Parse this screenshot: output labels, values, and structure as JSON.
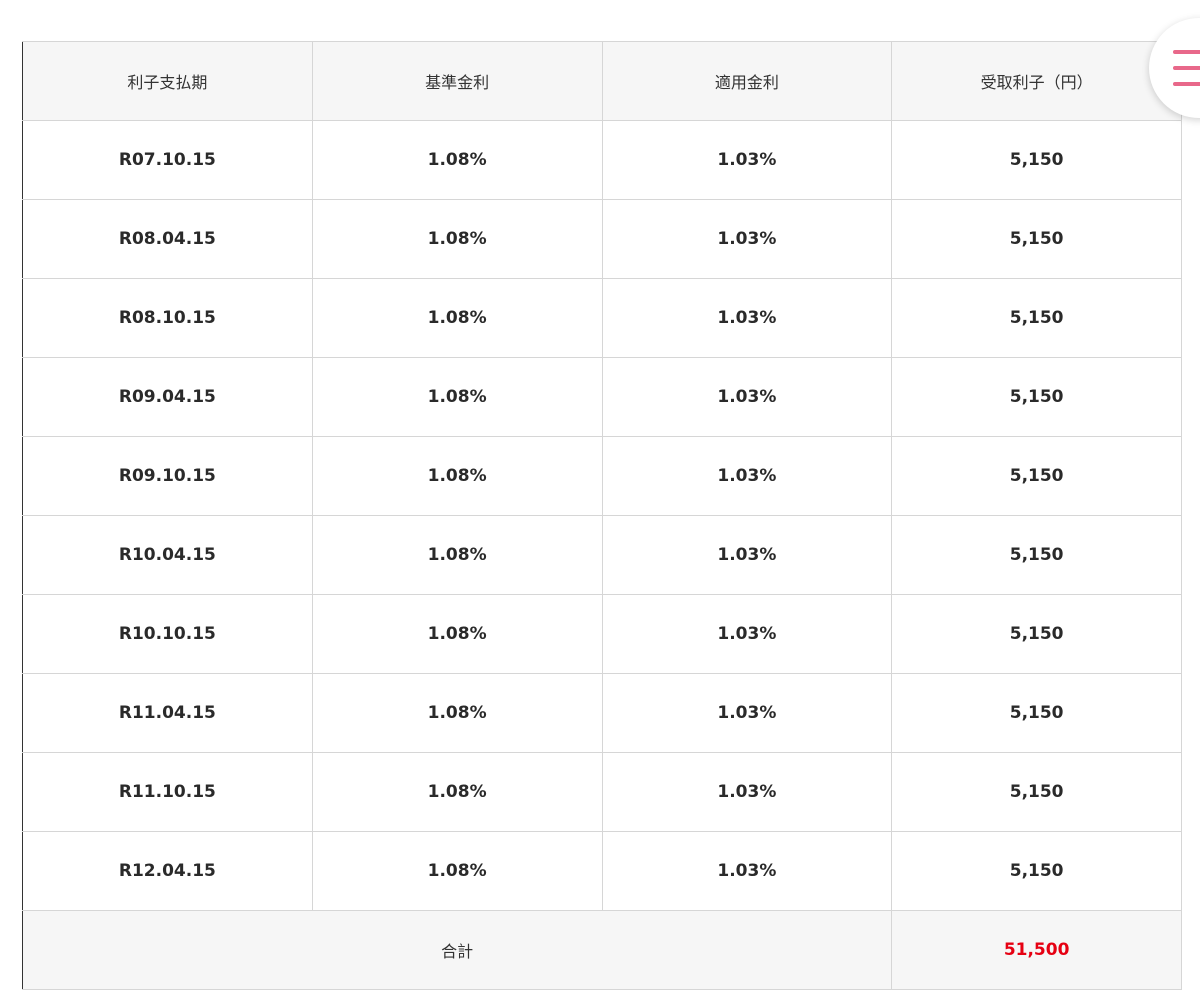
{
  "table": {
    "headers": [
      "利子支払期",
      "基準金利",
      "適用金利",
      "受取利子（円）"
    ],
    "rows": [
      [
        "R07.10.15",
        "1.08%",
        "1.03%",
        "5,150"
      ],
      [
        "R08.04.15",
        "1.08%",
        "1.03%",
        "5,150"
      ],
      [
        "R08.10.15",
        "1.08%",
        "1.03%",
        "5,150"
      ],
      [
        "R09.04.15",
        "1.08%",
        "1.03%",
        "5,150"
      ],
      [
        "R09.10.15",
        "1.08%",
        "1.03%",
        "5,150"
      ],
      [
        "R10.04.15",
        "1.08%",
        "1.03%",
        "5,150"
      ],
      [
        "R10.10.15",
        "1.08%",
        "1.03%",
        "5,150"
      ],
      [
        "R11.04.15",
        "1.08%",
        "1.03%",
        "5,150"
      ],
      [
        "R11.10.15",
        "1.08%",
        "1.03%",
        "5,150"
      ],
      [
        "R12.04.15",
        "1.08%",
        "1.03%",
        "5,150"
      ]
    ],
    "total": {
      "label": "合計",
      "value": "51,500"
    }
  },
  "menu": {
    "icon": "hamburger-menu-icon"
  },
  "colors": {
    "header_bg": "#f6f6f6",
    "border": "#d6d6d6",
    "total_value": "#e60012",
    "menu_accent": "#e8688a"
  }
}
